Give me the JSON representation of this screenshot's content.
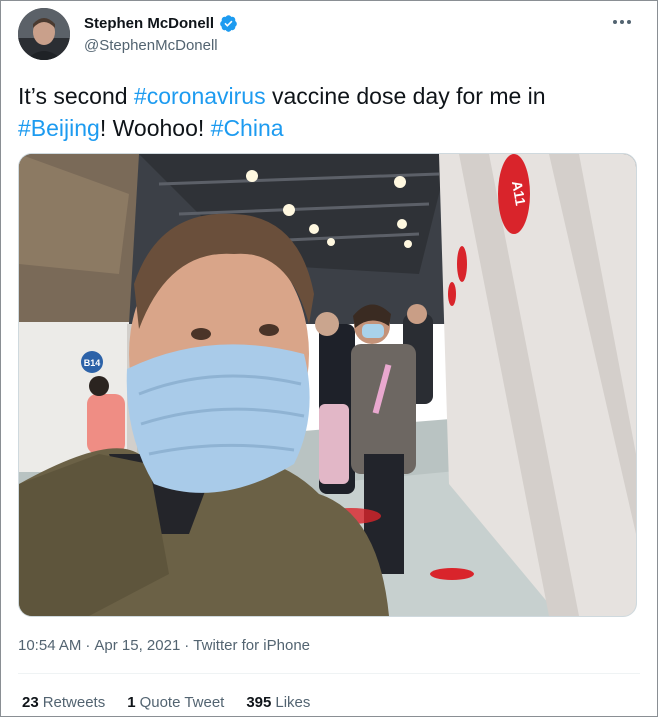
{
  "author": {
    "name": "Stephen McDonell",
    "handle": "@StephenMcDonell",
    "avatar_icon": "user-avatar-photo",
    "verified_icon": "verified-badge-icon"
  },
  "menu": {
    "more_icon": "more-horizontal-icon"
  },
  "tweet": {
    "segments": [
      {
        "text": "It’s second ",
        "type": "text"
      },
      {
        "text": "#coronavirus",
        "type": "hashtag"
      },
      {
        "text": " vaccine dose day for me in ",
        "type": "text"
      },
      {
        "text": "#Beijing",
        "type": "hashtag"
      },
      {
        "text": "! Woohoo! ",
        "type": "text"
      },
      {
        "text": "#China",
        "type": "hashtag"
      }
    ]
  },
  "media": {
    "sign_top_right": "A11",
    "sign_left": "B14"
  },
  "meta": {
    "time": "10:54 AM",
    "sep1": "·",
    "date": "Apr 15, 2021",
    "sep2": "·",
    "source": "Twitter for iPhone"
  },
  "stats": {
    "retweets_count": "23",
    "retweets_label": "Retweets",
    "quotes_count": "1",
    "quotes_label": "Quote Tweet",
    "likes_count": "395",
    "likes_label": "Likes"
  },
  "colors": {
    "link": "#1d9bf0",
    "text": "#0f1419",
    "secondary": "#536471",
    "verified": "#1d9bf0",
    "sign_red": "#d9242b"
  }
}
